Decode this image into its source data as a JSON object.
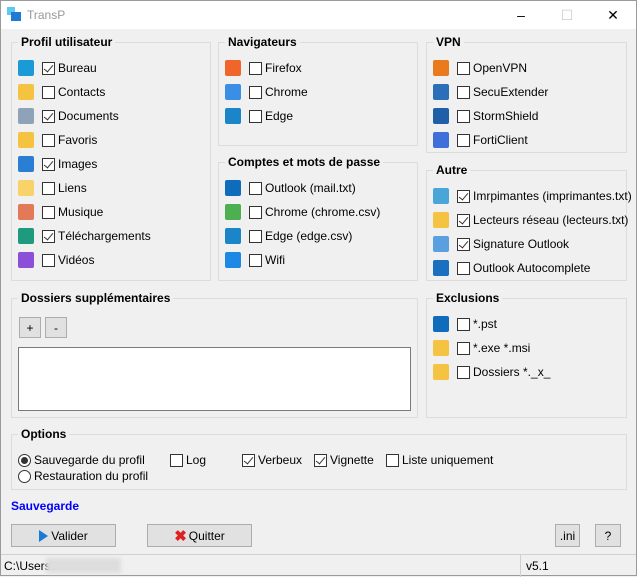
{
  "window": {
    "title": "TransP",
    "minimize": "–",
    "maximize": "☐",
    "close": "✕"
  },
  "groups": {
    "profil": {
      "title": "Profil utilisateur",
      "items": [
        {
          "label": "Bureau",
          "checked": true,
          "icon": "desktop-folder-icon",
          "color": "#1a9ad6"
        },
        {
          "label": "Contacts",
          "checked": false,
          "icon": "contacts-folder-icon",
          "color": "#f5c342"
        },
        {
          "label": "Documents",
          "checked": true,
          "icon": "documents-folder-icon",
          "color": "#8fa3b8"
        },
        {
          "label": "Favoris",
          "checked": false,
          "icon": "favorites-folder-icon",
          "color": "#f5c342"
        },
        {
          "label": "Images",
          "checked": true,
          "icon": "pictures-folder-icon",
          "color": "#2a7fd4"
        },
        {
          "label": "Liens",
          "checked": false,
          "icon": "links-folder-icon",
          "color": "#f8d36a"
        },
        {
          "label": "Musique",
          "checked": false,
          "icon": "music-folder-icon",
          "color": "#e27a5a"
        },
        {
          "label": "Téléchargements",
          "checked": true,
          "icon": "downloads-folder-icon",
          "color": "#1e9a7e"
        },
        {
          "label": "Vidéos",
          "checked": false,
          "icon": "videos-folder-icon",
          "color": "#8b4fd8"
        }
      ]
    },
    "navigateurs": {
      "title": "Navigateurs",
      "items": [
        {
          "label": "Firefox",
          "checked": false,
          "icon": "firefox-icon",
          "color": "#f0662a"
        },
        {
          "label": "Chrome",
          "checked": false,
          "icon": "chrome-icon",
          "color": "#3a8ee6"
        },
        {
          "label": "Edge",
          "checked": false,
          "icon": "edge-icon",
          "color": "#1a86c8"
        }
      ]
    },
    "comptes": {
      "title": "Comptes et mots de passe",
      "items": [
        {
          "label": "Outlook (mail.txt)",
          "checked": false,
          "icon": "outlook-icon",
          "color": "#0f6cbd"
        },
        {
          "label": "Chrome (chrome.csv)",
          "checked": false,
          "icon": "chrome-key-icon",
          "color": "#4caf50"
        },
        {
          "label": "Edge (edge.csv)",
          "checked": false,
          "icon": "edge-key-icon",
          "color": "#1a86c8"
        },
        {
          "label": "Wifi",
          "checked": false,
          "icon": "wifi-icon",
          "color": "#1e88e5"
        }
      ]
    },
    "vpn": {
      "title": "VPN",
      "items": [
        {
          "label": "OpenVPN",
          "checked": false,
          "icon": "openvpn-icon",
          "color": "#ea7a1e"
        },
        {
          "label": "SecuExtender",
          "checked": false,
          "icon": "secuextender-icon",
          "color": "#2a6fb8"
        },
        {
          "label": "StormShield",
          "checked": false,
          "icon": "stormshield-icon",
          "color": "#1f5fa8"
        },
        {
          "label": "FortiClient",
          "checked": false,
          "icon": "forticlient-icon",
          "color": "#3f6fd8"
        }
      ]
    },
    "autre": {
      "title": "Autre",
      "items": [
        {
          "label": "Imrpimantes (imprimantes.txt)",
          "checked": true,
          "icon": "printer-icon",
          "color": "#4aa6d8"
        },
        {
          "label": "Lecteurs réseau (lecteurs.txt)",
          "checked": true,
          "icon": "network-drive-icon",
          "color": "#f5c342"
        },
        {
          "label": "Signature Outlook",
          "checked": true,
          "icon": "signature-pen-icon",
          "color": "#5aa0e0"
        },
        {
          "label": "Outlook Autocomplete",
          "checked": false,
          "icon": "autocomplete-icon",
          "color": "#1a6fc0"
        }
      ]
    },
    "exclusions": {
      "title": "Exclusions",
      "items": [
        {
          "label": "*.pst",
          "checked": false,
          "icon": "pst-file-icon",
          "color": "#0f6cbd"
        },
        {
          "label": "*.exe *.msi",
          "checked": false,
          "icon": "executable-folder-icon",
          "color": "#f5c342"
        },
        {
          "label": "Dossiers *._x_",
          "checked": false,
          "icon": "excluded-folder-icon",
          "color": "#f5c342"
        }
      ]
    },
    "dossiers": {
      "title": "Dossiers supplémentaires",
      "add": "+",
      "remove": "-",
      "list_value": ""
    },
    "options": {
      "title": "Options",
      "radios": [
        {
          "label": "Sauvegarde du profil",
          "selected": true
        },
        {
          "label": "Restauration du profil",
          "selected": false
        }
      ],
      "checks": [
        {
          "label": "Log",
          "checked": false
        },
        {
          "label": "Verbeux",
          "checked": true
        },
        {
          "label": "Vignette",
          "checked": true
        },
        {
          "label": "Liste uniquement",
          "checked": false
        }
      ]
    }
  },
  "mode_label": "Sauvegarde",
  "mode_color": "#0000ff",
  "buttons": {
    "valider": "Valider",
    "quitter": "Quitter",
    "ini": ".ini",
    "help": "?"
  },
  "status": {
    "path": "C:\\Users\\",
    "version": "v5.1"
  }
}
